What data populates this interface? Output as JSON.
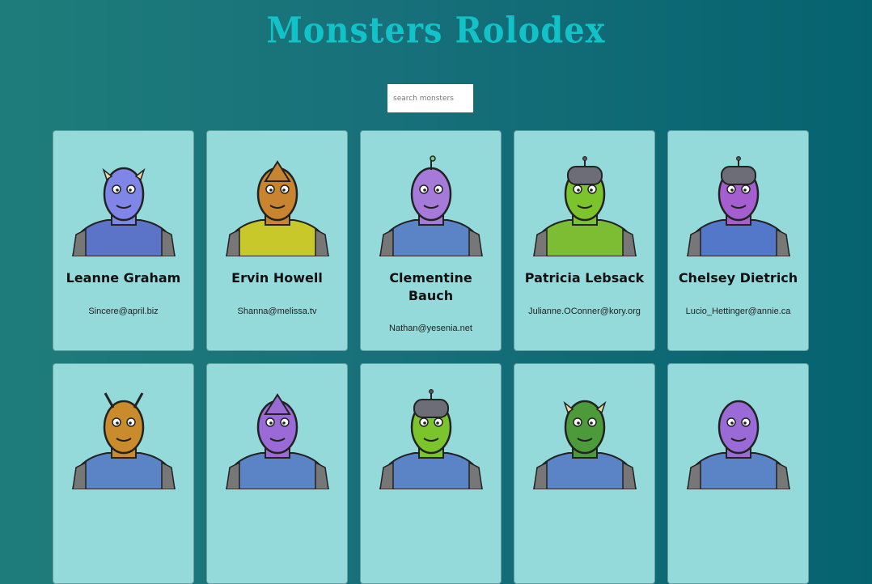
{
  "app": {
    "title": "Monsters Rolodex"
  },
  "search": {
    "placeholder": "search monsters",
    "value": ""
  },
  "monsters": [
    {
      "name": "Leanne Graham",
      "email": "Sincere@april.biz",
      "color": "#7f86e8",
      "shirt": "#5b74c7",
      "top": "horns"
    },
    {
      "name": "Ervin Howell",
      "email": "Shanna@melissa.tv",
      "color": "#c8842e",
      "shirt": "#c9c82a",
      "top": "cone"
    },
    {
      "name": "Clementine Bauch",
      "email": "Nathan@yesenia.net",
      "color": "#a67ad8",
      "shirt": "#5a84c6",
      "top": "antenna"
    },
    {
      "name": "Patricia Lebsack",
      "email": "Julianne.OConner@kory.org",
      "color": "#7cc42c",
      "shirt": "#7dbd34",
      "top": "helmet"
    },
    {
      "name": "Chelsey Dietrich",
      "email": "Lucio_Hettinger@annie.ca",
      "color": "#a55ed0",
      "shirt": "#5378c9",
      "top": "helmet"
    },
    {
      "name": "",
      "email": "",
      "color": "#c98b2c",
      "shirt": "#5a84c6",
      "top": "antenna2"
    },
    {
      "name": "",
      "email": "",
      "color": "#9a6ad6",
      "shirt": "#5a84c6",
      "top": "cone"
    },
    {
      "name": "",
      "email": "",
      "color": "#7cc42c",
      "shirt": "#5a84c6",
      "top": "helmet"
    },
    {
      "name": "",
      "email": "",
      "color": "#4c9a3a",
      "shirt": "#5a84c6",
      "top": "horns"
    },
    {
      "name": "",
      "email": "",
      "color": "#9a6ad6",
      "shirt": "#5a84c6",
      "top": "none"
    }
  ]
}
